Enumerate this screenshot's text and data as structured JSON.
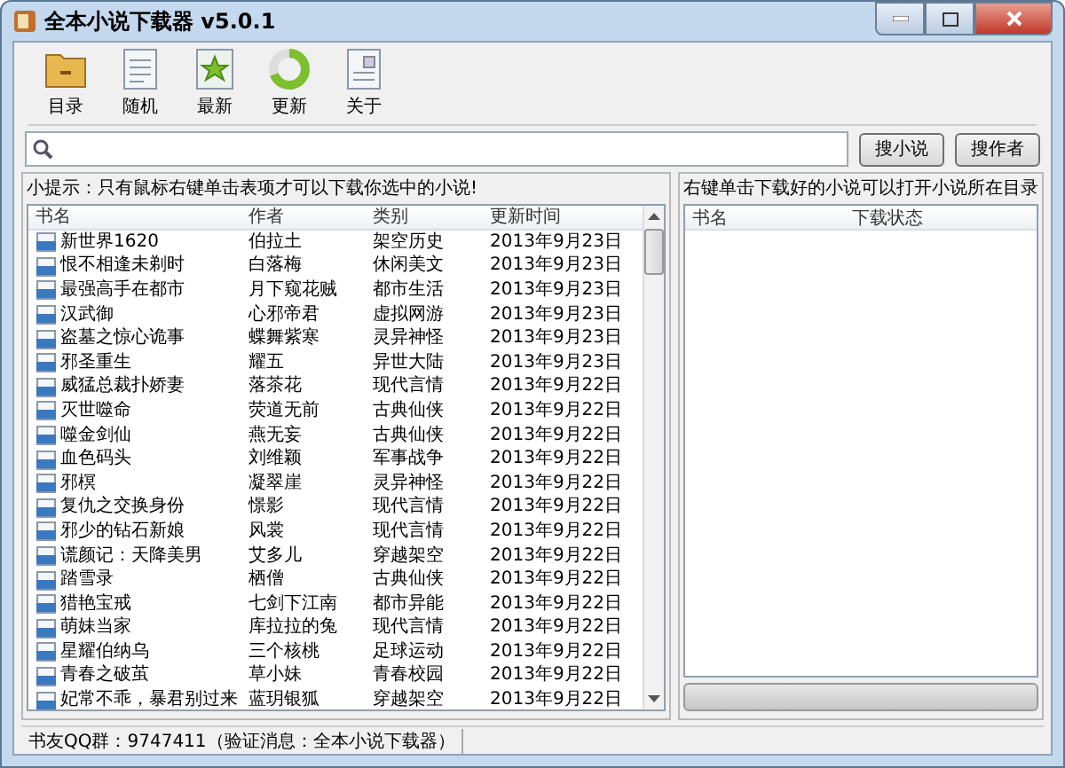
{
  "window": {
    "title": "全本小说下载器  v5.0.1"
  },
  "toolbar": [
    {
      "label": "目录",
      "kind": "folder"
    },
    {
      "label": "随机",
      "kind": "list"
    },
    {
      "label": "最新",
      "kind": "star"
    },
    {
      "label": "更新",
      "kind": "ring"
    },
    {
      "label": "关于",
      "kind": "about"
    }
  ],
  "search": {
    "buttons": [
      "搜小说",
      "搜作者"
    ]
  },
  "hint": "小提示：只有鼠标右键单击表项才可以下载你选中的小说!",
  "right_hint": "右键单击下载好的小说可以打开小说所在目录",
  "table": {
    "columns": [
      "书名",
      "作者",
      "类别",
      "更新时间"
    ],
    "rows": [
      {
        "title": "新世界1620",
        "author": "伯拉土",
        "category": "架空历史",
        "updated": "2013年9月23日"
      },
      {
        "title": "恨不相逢未剃时",
        "author": "白落梅",
        "category": "休闲美文",
        "updated": "2013年9月23日"
      },
      {
        "title": "最强高手在都市",
        "author": "月下窥花贼",
        "category": "都市生活",
        "updated": "2013年9月23日"
      },
      {
        "title": "汉武御",
        "author": "心邪帝君",
        "category": "虚拟网游",
        "updated": "2013年9月23日"
      },
      {
        "title": "盗墓之惊心诡事",
        "author": "蝶舞紫寒",
        "category": "灵异神怪",
        "updated": "2013年9月23日"
      },
      {
        "title": "邪圣重生",
        "author": "耀五",
        "category": "异世大陆",
        "updated": "2013年9月23日"
      },
      {
        "title": "威猛总裁扑娇妻",
        "author": "落茶花",
        "category": "现代言情",
        "updated": "2013年9月22日"
      },
      {
        "title": "灭世噬命",
        "author": "荧道无前",
        "category": "古典仙侠",
        "updated": "2013年9月22日"
      },
      {
        "title": "噬金剑仙",
        "author": "燕无妄",
        "category": "古典仙侠",
        "updated": "2013年9月22日"
      },
      {
        "title": "血色码头",
        "author": "刘维颖",
        "category": "军事战争",
        "updated": "2013年9月22日"
      },
      {
        "title": "邪榠",
        "author": "凝翠崖",
        "category": "灵异神怪",
        "updated": "2013年9月22日"
      },
      {
        "title": "复仇之交换身份",
        "author": "憬影",
        "category": "现代言情",
        "updated": "2013年9月22日"
      },
      {
        "title": "邪少的钻石新娘",
        "author": "风裳",
        "category": "现代言情",
        "updated": "2013年9月22日"
      },
      {
        "title": "谎颜记：天降美男",
        "author": "艾多儿",
        "category": "穿越架空",
        "updated": "2013年9月22日"
      },
      {
        "title": "踏雪录",
        "author": "栖僧",
        "category": "古典仙侠",
        "updated": "2013年9月22日"
      },
      {
        "title": "猎艳宝戒",
        "author": "七剑下江南",
        "category": "都市异能",
        "updated": "2013年9月22日"
      },
      {
        "title": "萌妹当家",
        "author": "库拉拉的兔",
        "category": "现代言情",
        "updated": "2013年9月22日"
      },
      {
        "title": "星耀伯纳乌",
        "author": "三个核桃",
        "category": "足球运动",
        "updated": "2013年9月22日"
      },
      {
        "title": "青春之破茧",
        "author": "草小妹",
        "category": "青春校园",
        "updated": "2013年9月22日"
      },
      {
        "title": "妃常不乖，暴君别过来",
        "author": "蓝玥银狐",
        "category": "穿越架空",
        "updated": "2013年9月22日"
      }
    ]
  },
  "downloads": {
    "columns": [
      "书名",
      "下载状态"
    ],
    "progress": {
      "level": 0
    }
  },
  "status_bar": "书友QQ群：9747411（验证消息：全本小说下载器）"
}
